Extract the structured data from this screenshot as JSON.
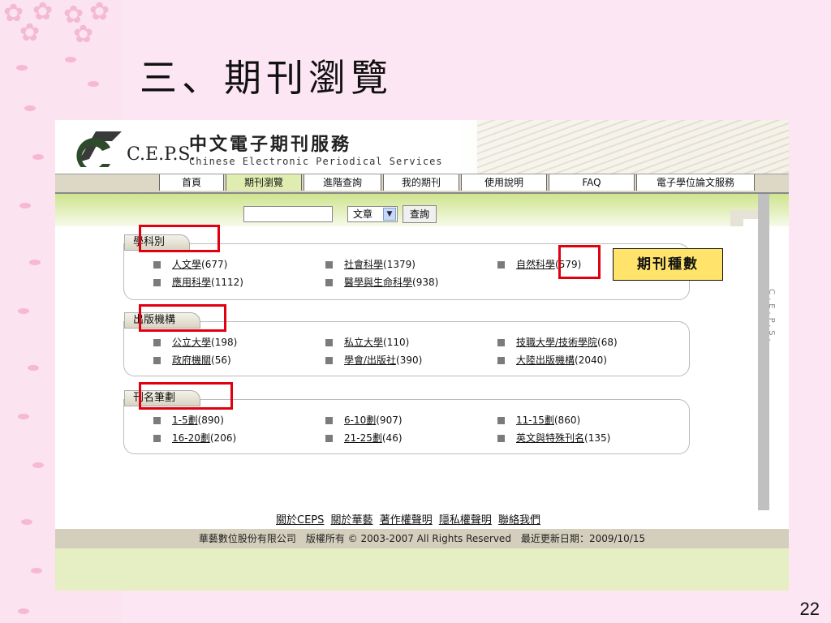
{
  "slide": {
    "title": "三、期刊瀏覽",
    "page_number": "22"
  },
  "site": {
    "logo_text": "C.E.P.S.",
    "title": "中文電子期刊服務",
    "subtitle": "Chinese Electronic Periodical Services",
    "side_label": "C.E.P.S."
  },
  "nav": [
    "首頁",
    "期刊瀏覽",
    "進階查詢",
    "我的期刊",
    "使用說明",
    "FAQ",
    "電子學位論文服務"
  ],
  "search": {
    "select_value": "文章",
    "button": "查詢"
  },
  "sections": [
    {
      "title": "學科別",
      "items": [
        {
          "label": "人文學",
          "count": "(677)"
        },
        {
          "label": "社會科學",
          "count": "(1379)"
        },
        {
          "label": "自然科學",
          "count": "(579)"
        },
        {
          "label": "應用科學",
          "count": "(1112)"
        },
        {
          "label": "醫學與生命科學",
          "count": "(938)"
        }
      ]
    },
    {
      "title": "出版機構",
      "items": [
        {
          "label": "公立大學",
          "count": "(198)"
        },
        {
          "label": "私立大學",
          "count": "(110)"
        },
        {
          "label": "技職大學/技術學院",
          "count": "(68)"
        },
        {
          "label": "政府機關",
          "count": "(56)"
        },
        {
          "label": "學會/出版社",
          "count": "(390)"
        },
        {
          "label": "大陸出版機構",
          "count": "(2040)"
        }
      ]
    },
    {
      "title": "刊名筆劃",
      "items": [
        {
          "label": "1-5劃",
          "count": "(890)"
        },
        {
          "label": "6-10劃",
          "count": "(907)"
        },
        {
          "label": "11-15劃",
          "count": "(860)"
        },
        {
          "label": "16-20劃",
          "count": "(206)"
        },
        {
          "label": "21-25劃",
          "count": "(46)"
        },
        {
          "label": "英文與特殊刊名",
          "count": "(135)"
        }
      ]
    }
  ],
  "callout": "期刊種數",
  "footer": {
    "links": [
      "關於CEPS",
      "關於華藝",
      "著作權聲明",
      "隱私權聲明",
      "聯絡我們"
    ],
    "copyright": "華藝數位股份有限公司　版權所有 © 2003-2007 All Rights Reserved　最近更新日期：2009/10/15"
  },
  "colors": {
    "highlight_red": "#e00010",
    "callout_yellow": "#ffe36a",
    "nav_active": "#e0edb0"
  }
}
